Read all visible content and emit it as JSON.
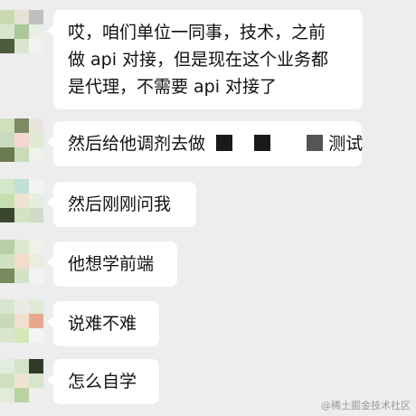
{
  "messages": [
    {
      "lines": [
        "哎，咱们单位一同事，技术，之前",
        "做 api 对接，但是现在这个业务都",
        "是代理，不需要 api 对接了"
      ],
      "avatar_colors": [
        "#c9d9b0",
        "#e6e2d6",
        "#bfbfbf",
        "#d7e6cf",
        "#a9c79a",
        "#e9efe2",
        "#4d5a3c",
        "#d9e4d0",
        "#f2f2f2"
      ]
    },
    {
      "before": "然后给他调剂去做",
      "after": "测试",
      "avatar_colors": [
        "#cfe0bd",
        "#7d8a66",
        "#e8e6dc",
        "#c7dbbf",
        "#f2d6cf",
        "#dfe9d4",
        "#6c7a4f",
        "#c9dcb7",
        "#eef2ea"
      ]
    },
    {
      "lines": [
        "然后刚刚问我"
      ],
      "avatar_colors": [
        "#d6e6c9",
        "#bfe0d6",
        "#f3f3f3",
        "#c5dfae",
        "#f0e2d3",
        "#e6eee0",
        "#3a4630",
        "#d3e4c4",
        "#cfdbc8"
      ]
    },
    {
      "lines": [
        "他想学前端"
      ],
      "avatar_colors": [
        "#b9d0a6",
        "#dce9cf",
        "#eef2e8",
        "#cfe2bf",
        "#f3dcc9",
        "#e9eedf",
        "#7a8a5e",
        "#d4e2c8",
        "#f3f3f3"
      ]
    },
    {
      "lines": [
        "说难不难"
      ],
      "avatar_colors": [
        "#d9e6cf",
        "#e9ece4",
        "#e0ead6",
        "#c9d9ba",
        "#f0e0d0",
        "#e8a890",
        "#dbe6d0",
        "#d4e8b8",
        "#f4f4f4"
      ]
    },
    {
      "lines": [
        "怎么自学"
      ],
      "avatar_colors": [
        "#e2ece0",
        "#d5e4c9",
        "#2f3b28",
        "#cfe0c0",
        "#f1e3d3",
        "#d7e5cb",
        "#e2ead9",
        "#b8d39e",
        "#ededed"
      ]
    }
  ],
  "watermark": "@稀土掘金技术社区"
}
